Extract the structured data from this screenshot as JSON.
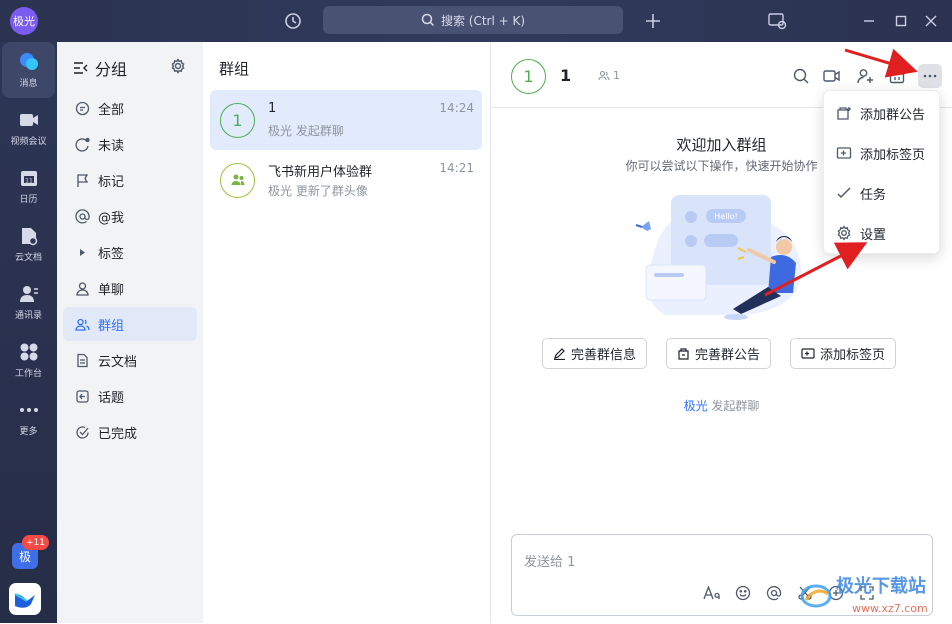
{
  "titlebar": {
    "user_avatar": "极光",
    "search_placeholder": "搜索 (Ctrl + K)",
    "icons": [
      "history-icon",
      "plus-icon",
      "screenshot-icon",
      "minimize-icon",
      "maximize-icon",
      "close-icon"
    ]
  },
  "leftnav": {
    "items": [
      {
        "label": "消息",
        "icon": "message-icon"
      },
      {
        "label": "视频会议",
        "icon": "video-icon"
      },
      {
        "label": "日历",
        "icon": "calendar-icon"
      },
      {
        "label": "云文档",
        "icon": "doc-icon"
      },
      {
        "label": "通讯录",
        "icon": "contacts-icon"
      },
      {
        "label": "工作台",
        "icon": "workbench-icon"
      },
      {
        "label": "更多",
        "icon": "more-icon"
      }
    ],
    "bottom_avatar": "极",
    "bottom_badge": "+11"
  },
  "groups": {
    "title": "分组",
    "items": [
      {
        "label": "全部"
      },
      {
        "label": "未读"
      },
      {
        "label": "标记"
      },
      {
        "label": "@我"
      },
      {
        "label": "标签"
      },
      {
        "label": "单聊"
      },
      {
        "label": "群组"
      },
      {
        "label": "云文档"
      },
      {
        "label": "话题"
      },
      {
        "label": "已完成"
      }
    ]
  },
  "chatlist": {
    "title": "群组",
    "items": [
      {
        "avatar": "1",
        "name": "1",
        "sub": "极光 发起群聊",
        "time": "14:24"
      },
      {
        "avatar": "",
        "name": "飞书新用户体验群",
        "sub": "极光 更新了群头像",
        "time": "14:21"
      }
    ]
  },
  "main": {
    "avatar": "1",
    "name": "1",
    "member_count": "1",
    "welcome_title": "欢迎加入群组",
    "welcome_sub": "你可以尝试以下操作，快速开始协作",
    "illus_bubble": "Hello!",
    "actions": [
      "完善群信息",
      "完善群公告",
      "添加标签页"
    ],
    "sys_user": "极光",
    "sys_msg": "发起群聊",
    "input_placeholder": "发送给 1"
  },
  "menu": {
    "items": [
      "添加群公告",
      "添加标签页",
      "任务",
      "设置"
    ]
  },
  "watermark": {
    "line1": "极光下载站",
    "line2": "www.xz7.com"
  },
  "colors": {
    "accent": "#3370ff",
    "sidebar": "#2e3656",
    "group_green": "#4caf50",
    "arrow_red": "#e02020"
  }
}
